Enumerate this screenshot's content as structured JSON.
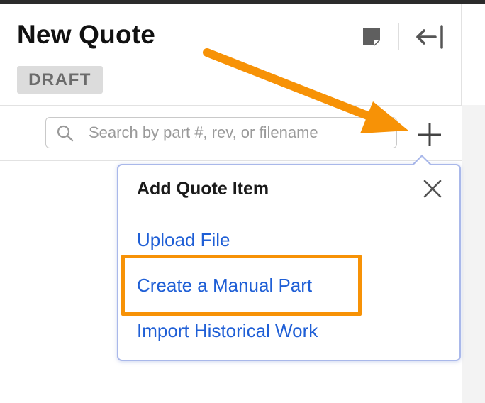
{
  "header": {
    "title": "New Quote",
    "status_badge": "DRAFT"
  },
  "search": {
    "placeholder": "Search by part #, rev, or filename"
  },
  "add_item_popover": {
    "title": "Add Quote Item",
    "items": [
      {
        "label": "Upload File"
      },
      {
        "label": "Create a Manual Part"
      },
      {
        "label": "Import Historical Work"
      }
    ]
  },
  "annotations": {
    "highlight_color": "#f79206",
    "highlighted_item": "Create a Manual Part"
  },
  "icons": {
    "notes": "sticky-note-icon",
    "collapse": "collapse-panel-icon",
    "search": "search-icon",
    "add": "plus-icon",
    "close": "close-icon"
  },
  "colors": {
    "link": "#1f5fd6",
    "badge_bg": "#dcdcdc",
    "popover_border": "#a9b8ea"
  }
}
